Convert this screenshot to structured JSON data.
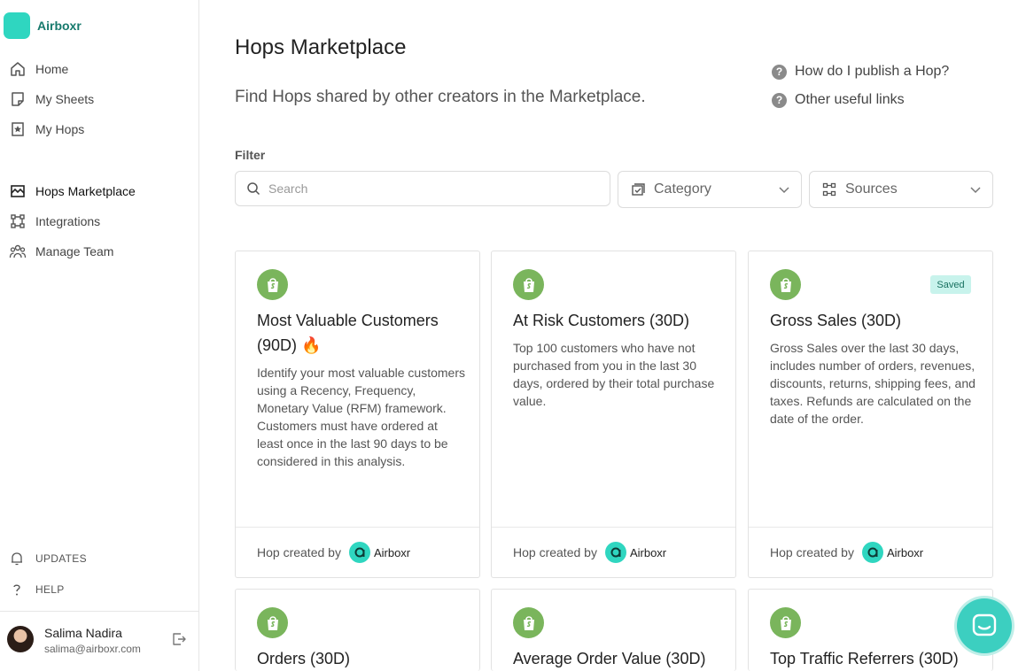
{
  "brand": {
    "name": "Airboxr"
  },
  "sidebar": {
    "items": [
      {
        "label": "Home"
      },
      {
        "label": "My Sheets"
      },
      {
        "label": "My Hops"
      },
      {
        "label": "Hops Marketplace"
      },
      {
        "label": "Integrations"
      },
      {
        "label": "Manage Team"
      }
    ],
    "footer": [
      {
        "label": "UPDATES"
      },
      {
        "label": "HELP"
      }
    ],
    "user": {
      "name": "Salima Nadira",
      "email": "salima@airboxr.com"
    }
  },
  "page": {
    "title": "Hops Marketplace",
    "subtitle": "Find Hops shared by other creators in the Marketplace.",
    "help_links": [
      {
        "label": "How do I publish a Hop?"
      },
      {
        "label": "Other useful links"
      }
    ],
    "filter_label": "Filter",
    "search_placeholder": "Search",
    "category_label": "Category",
    "sources_label": "Sources"
  },
  "cards": [
    {
      "title": "Most Valuable Customers (90D) 🔥",
      "description": "Identify your most valuable customers using a Recency, Frequency, Monetary Value (RFM) framework. Customers must have ordered at least once in the last 90 days to be considered in this analysis.",
      "created_by_label": "Hop created by",
      "creator": "Airboxr",
      "badge": ""
    },
    {
      "title": "At Risk Customers (30D)",
      "description": "Top 100 customers who have not purchased from you in the last 30 days, ordered by their total purchase value.",
      "created_by_label": "Hop created by",
      "creator": "Airboxr",
      "badge": ""
    },
    {
      "title": "Gross Sales (30D)",
      "description": "Gross Sales over the last 30 days, includes number of orders, revenues, discounts, returns, shipping fees, and taxes. Refunds are calculated on the date of the order.",
      "created_by_label": "Hop created by",
      "creator": "Airboxr",
      "badge": "Saved"
    },
    {
      "title": "Orders (30D)"
    },
    {
      "title": "Average Order Value (30D)"
    },
    {
      "title": "Top Traffic Referrers (30D)"
    }
  ],
  "icons": {
    "shopify": "shopify-bag-icon",
    "question": "question-circle-icon",
    "chat": "chat-icon"
  },
  "colors": {
    "accent": "#2fd6c0",
    "shopify_green": "#7ab55c",
    "saved_badge_bg": "#c8f3ec"
  }
}
